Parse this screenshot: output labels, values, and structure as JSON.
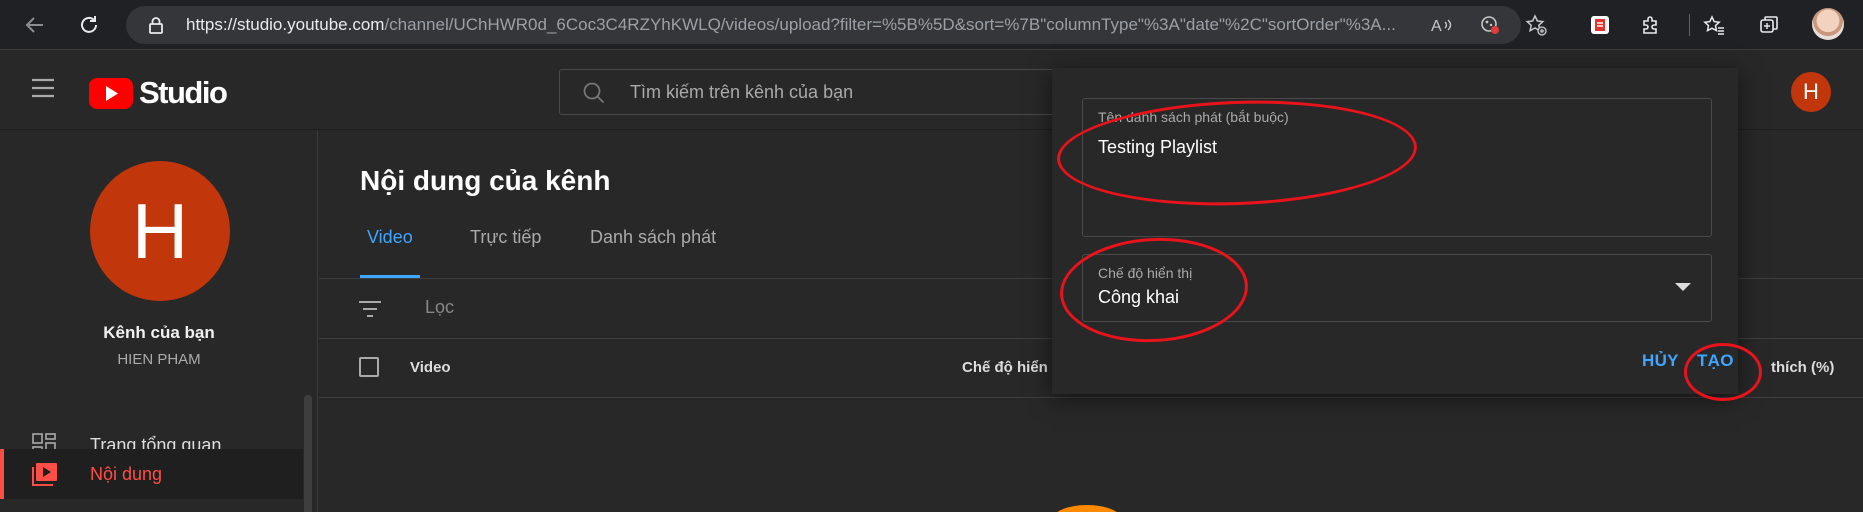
{
  "browser": {
    "url_host": "https://studio.youtube.com",
    "url_path": "/channel/UChHWR0d_6Coc3C4RZYhKWLQ/videos/upload?filter=%5B%5D&sort=%7B\"columnType\"%3A\"date\"%2C\"sortOrder\"%3A...",
    "icons": [
      "back-icon",
      "reload-icon",
      "lock-icon",
      "read-aloud-icon",
      "tracking-prevention-icon",
      "add-favorite-icon",
      "extension-icon",
      "puzzle-icon",
      "favorites-icon",
      "collections-icon",
      "profile-icon"
    ]
  },
  "header": {
    "logo_text": "Studio",
    "search_placeholder": "Tìm kiếm trên kênh của bạn",
    "avatar_letter": "H"
  },
  "sidebar": {
    "avatar_letter": "H",
    "channel_title": "Kênh của bạn",
    "channel_name": "HIEN PHAM",
    "items": [
      {
        "label": "Trang tổng quan",
        "icon": "dashboard-icon",
        "active": false
      },
      {
        "label": "Nội dung",
        "icon": "content-icon",
        "active": true
      }
    ]
  },
  "main": {
    "title": "Nội dung của kênh",
    "tabs": [
      {
        "label": "Video",
        "active": true
      },
      {
        "label": "Trực tiếp",
        "active": false
      },
      {
        "label": "Danh sách phát",
        "active": false
      }
    ],
    "filter_label": "Lọc",
    "columns": {
      "video": "Video",
      "visibility": "Chế độ hiển t",
      "likes": "thích (%)"
    }
  },
  "dialog": {
    "name_label": "Tên danh sách phát (bắt buộc)",
    "name_value": "Testing Playlist",
    "visibility_label": "Chế độ hiển thị",
    "visibility_value": "Công khai",
    "cancel_label": "HỦY",
    "create_label": "TẠO"
  },
  "colors": {
    "accent": "#3ea6ff",
    "brand_red": "#ff0000",
    "avatar": "#c2360c",
    "annotation": "#e8131b"
  }
}
